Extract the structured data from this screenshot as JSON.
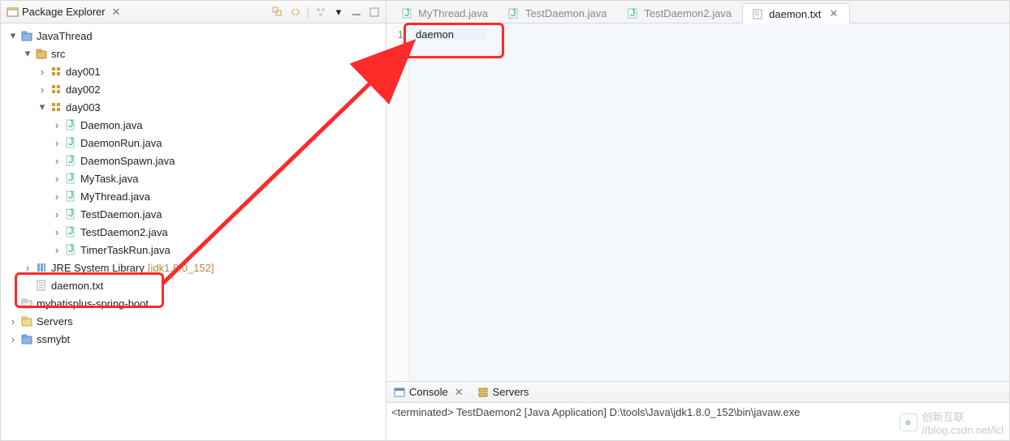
{
  "sidebar": {
    "title": "Package Explorer",
    "tree": {
      "project": "JavaThread",
      "src": "src",
      "pkg1": "day001",
      "pkg2": "day002",
      "pkg3": "day003",
      "files": [
        "Daemon.java",
        "DaemonRun.java",
        "DaemonSpawn.java",
        "MyTask.java",
        "MyThread.java",
        "TestDaemon.java",
        "TestDaemon2.java",
        "TimerTaskRun.java"
      ],
      "jre_label": "JRE System Library",
      "jre_version": "[jdk1.8.0_152]",
      "daemon_txt": "daemon.txt",
      "project2": "mybatisplus-spring-boot",
      "project3": "Servers",
      "project4": "ssmybt"
    }
  },
  "editor": {
    "tabs": [
      {
        "label": "MyThread.java",
        "active": false,
        "kind": "java"
      },
      {
        "label": "TestDaemon.java",
        "active": false,
        "kind": "java"
      },
      {
        "label": "TestDaemon2.java",
        "active": false,
        "kind": "java"
      },
      {
        "label": "daemon.txt",
        "active": true,
        "kind": "txt"
      }
    ],
    "gutter_line": "1",
    "content_line": "daemon"
  },
  "console": {
    "tabs": {
      "console": "Console",
      "servers": "Servers"
    },
    "status": "<terminated> TestDaemon2 [Java Application] D:\\tools\\Java\\jdk1.8.0_152\\bin\\javaw.exe"
  },
  "watermark": {
    "brand": "创新互联",
    "url": "//blog.csdn.net/lcl"
  }
}
